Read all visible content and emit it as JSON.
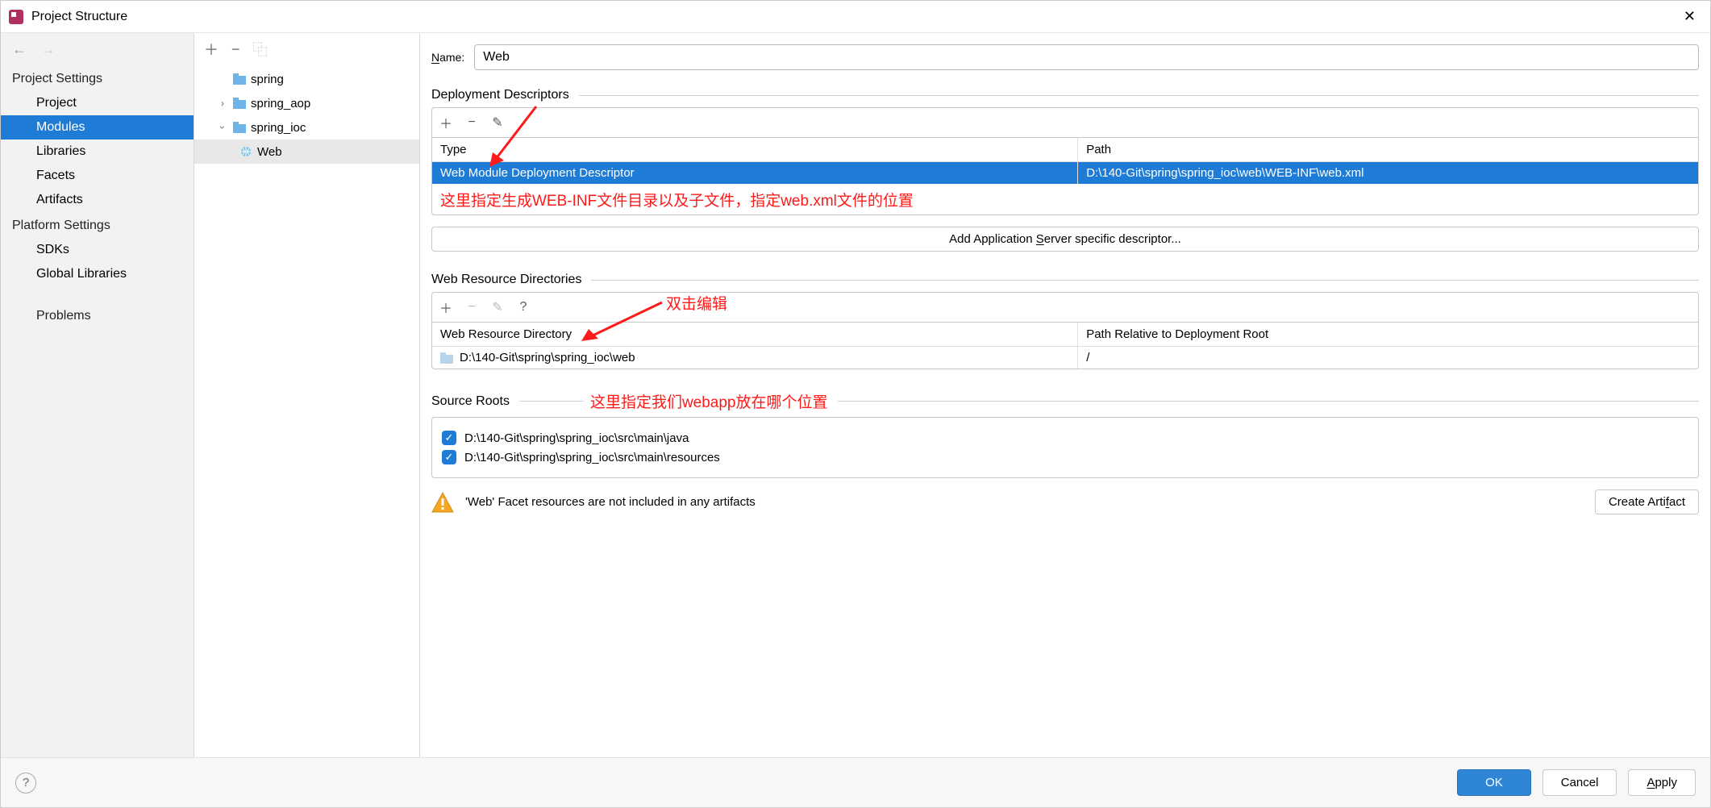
{
  "window": {
    "title": "Project Structure"
  },
  "left": {
    "section1": "Project Settings",
    "items1": [
      "Project",
      "Modules",
      "Libraries",
      "Facets",
      "Artifacts"
    ],
    "section2": "Platform Settings",
    "items2": [
      "SDKs",
      "Global Libraries"
    ],
    "problems": "Problems"
  },
  "tree": {
    "n0": "spring",
    "n1": "spring_aop",
    "n2": "spring_ioc",
    "n3": "Web"
  },
  "name": {
    "label": "Name:",
    "value": "Web"
  },
  "deploy": {
    "title": "Deployment Descriptors",
    "col1": "Type",
    "col2": "Path",
    "row_type": "Web Module Deployment Descriptor",
    "row_path": "D:\\140-Git\\spring\\spring_ioc\\web\\WEB-INF\\web.xml",
    "add_server_btn": "Add Application Server specific descriptor..."
  },
  "webres": {
    "title": "Web Resource Directories",
    "col1": "Web Resource Directory",
    "col2": "Path Relative to Deployment Root",
    "row_dir": "D:\\140-Git\\spring\\spring_ioc\\web",
    "row_rel": "/"
  },
  "srcroots": {
    "title": "Source Roots",
    "r1": "D:\\140-Git\\spring\\spring_ioc\\src\\main\\java",
    "r2": "D:\\140-Git\\spring\\spring_ioc\\src\\main\\resources"
  },
  "warning": {
    "text": "'Web' Facet resources are not included in any artifacts",
    "btn": "Create Artifact"
  },
  "annotations": {
    "a1": "这里指定生成WEB-INF文件目录以及子文件，指定web.xml文件的位置",
    "a2": "双击编辑",
    "a3": "这里指定我们webapp放在哪个位置"
  },
  "footer": {
    "ok": "OK",
    "cancel": "Cancel",
    "apply": "Apply"
  }
}
